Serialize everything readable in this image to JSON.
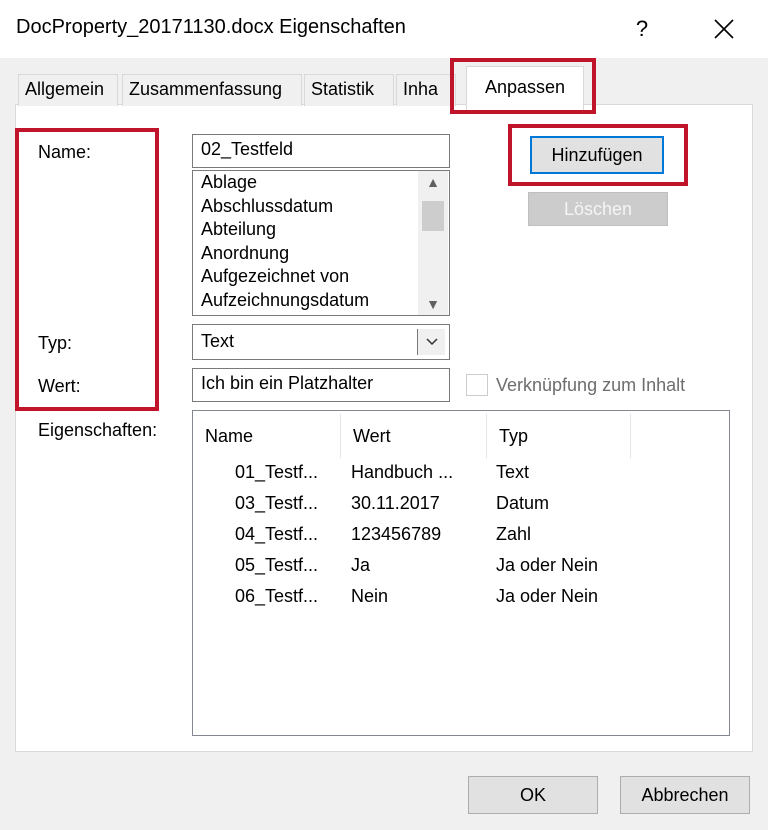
{
  "window": {
    "title": "DocProperty_20171130.docx Eigenschaften",
    "help_label": "?",
    "close_label": "✕"
  },
  "tabs": [
    {
      "label": "Allgemein"
    },
    {
      "label": "Zusammenfassung"
    },
    {
      "label": "Statistik"
    },
    {
      "label": "Inha"
    },
    {
      "label": "Anpassen",
      "active": true
    }
  ],
  "form": {
    "name_label": "Name:",
    "type_label": "Typ:",
    "value_label": "Wert:",
    "properties_label": "Eigenschaften:",
    "name_value": "02_Testfeld",
    "name_list": [
      "Ablage",
      "Abschlussdatum",
      "Abteilung",
      "Anordnung",
      "Aufgezeichnet von",
      "Aufzeichnungsdatum"
    ],
    "type_value": "Text",
    "value_value": "Ich bin ein Platzhalter",
    "link_checkbox_label": "Verknüpfung zum Inhalt",
    "add_button": "Hinzufügen",
    "delete_button": "Löschen"
  },
  "properties_table": {
    "columns": [
      "Name",
      "Wert",
      "Typ"
    ],
    "rows": [
      [
        "01_Testf...",
        "Handbuch ...",
        "Text"
      ],
      [
        "03_Testf...",
        "30.11.2017",
        "Datum"
      ],
      [
        "04_Testf...",
        "123456789",
        "Zahl"
      ],
      [
        "05_Testf...",
        "Ja",
        "Ja oder Nein"
      ],
      [
        "06_Testf...",
        "Nein",
        "Ja oder Nein"
      ]
    ]
  },
  "footer": {
    "ok_button": "OK",
    "cancel_button": "Abbrechen"
  },
  "colors": {
    "highlight_red": "#c0142a",
    "focus_blue": "#0078d7"
  }
}
